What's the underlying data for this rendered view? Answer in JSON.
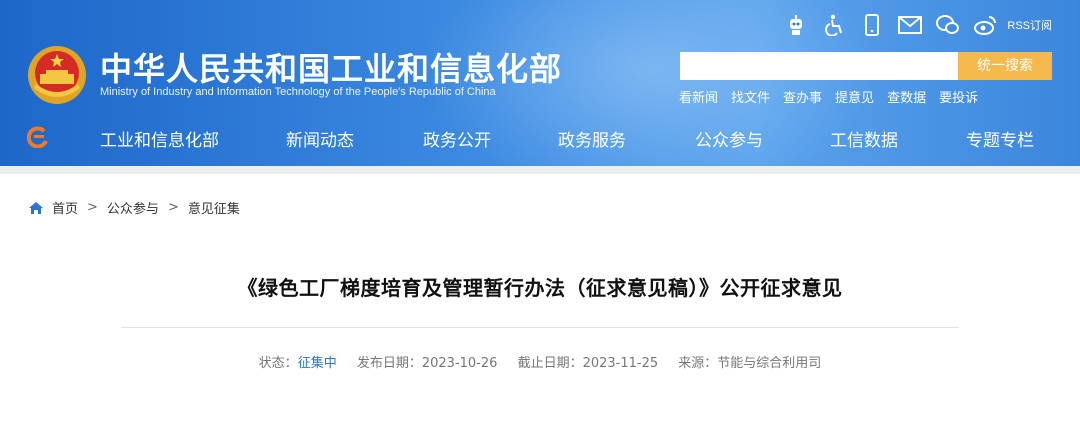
{
  "site": {
    "title": "中华人民共和国工业和信息化部",
    "subtitle": "Ministry of Industry and Information Technology of the People's Republic of China"
  },
  "top_icons": [
    "robot-icon",
    "accessibility-icon",
    "mobile-icon",
    "mail-icon",
    "wechat-icon",
    "weibo-icon"
  ],
  "rss_label": "RSS订阅",
  "search": {
    "placeholder": "",
    "button_label": "统一搜索"
  },
  "quick_links": [
    "看新闻",
    "找文件",
    "查办事",
    "提意见",
    "查数据",
    "要投诉"
  ],
  "nav": [
    "工业和信息化部",
    "新闻动态",
    "政务公开",
    "政务服务",
    "公众参与",
    "工信数据",
    "专题专栏"
  ],
  "breadcrumb": [
    "首页",
    "公众参与",
    "意见征集"
  ],
  "breadcrumb_separator": ">",
  "article": {
    "title": "《绿色工厂梯度培育及管理暂行办法（征求意见稿）》公开征求意见",
    "status_label": "状态：",
    "status_value": "征集中",
    "publish_label": "发布日期：",
    "publish_date": "2023-10-26",
    "deadline_label": "截止日期：",
    "deadline_date": "2023-11-25",
    "source_label": "来源：",
    "source_value": "节能与综合利用司"
  },
  "colors": {
    "header_blue": "#2e7cd8",
    "search_button": "#f5b84d",
    "status_blue": "#2a76d2"
  }
}
